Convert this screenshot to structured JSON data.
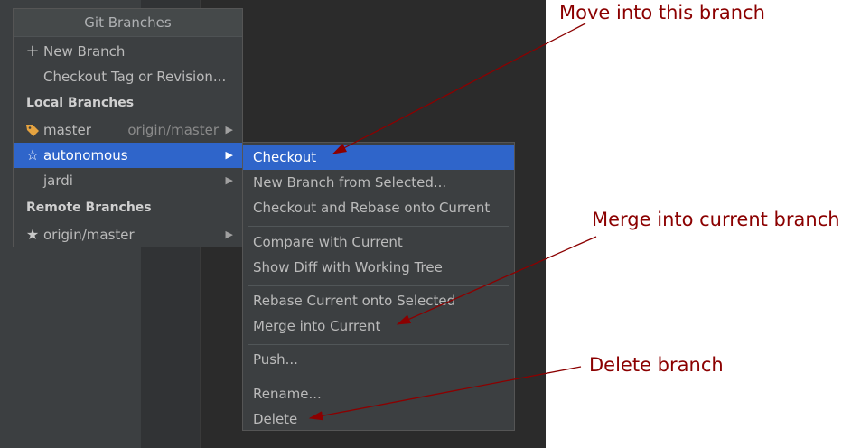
{
  "popup": {
    "title": "Git Branches",
    "new_branch": "New Branch",
    "checkout_tag": "Checkout Tag or Revision...",
    "local_header": "Local Branches",
    "remote_header": "Remote Branches",
    "local_branches": [
      {
        "name": "master",
        "tracking": "origin/master",
        "icon": "tag-icon"
      },
      {
        "name": "autonomous",
        "tracking": "",
        "icon": "star-outline-icon"
      },
      {
        "name": "jardi",
        "tracking": "",
        "icon": ""
      }
    ],
    "remote_branches": [
      {
        "name": "origin/master",
        "icon": "star-filled-icon"
      }
    ]
  },
  "submenu": {
    "items": [
      "Checkout",
      "New Branch from Selected...",
      "Checkout and Rebase onto Current",
      "Compare with Current",
      "Show Diff with Working Tree",
      "Rebase Current onto Selected",
      "Merge into Current",
      "Push...",
      "Rename...",
      "Delete"
    ]
  },
  "annotations": {
    "move": "Move into this branch",
    "merge": "Merge into current branch",
    "delete": "Delete branch",
    "color": "#8b0000"
  }
}
